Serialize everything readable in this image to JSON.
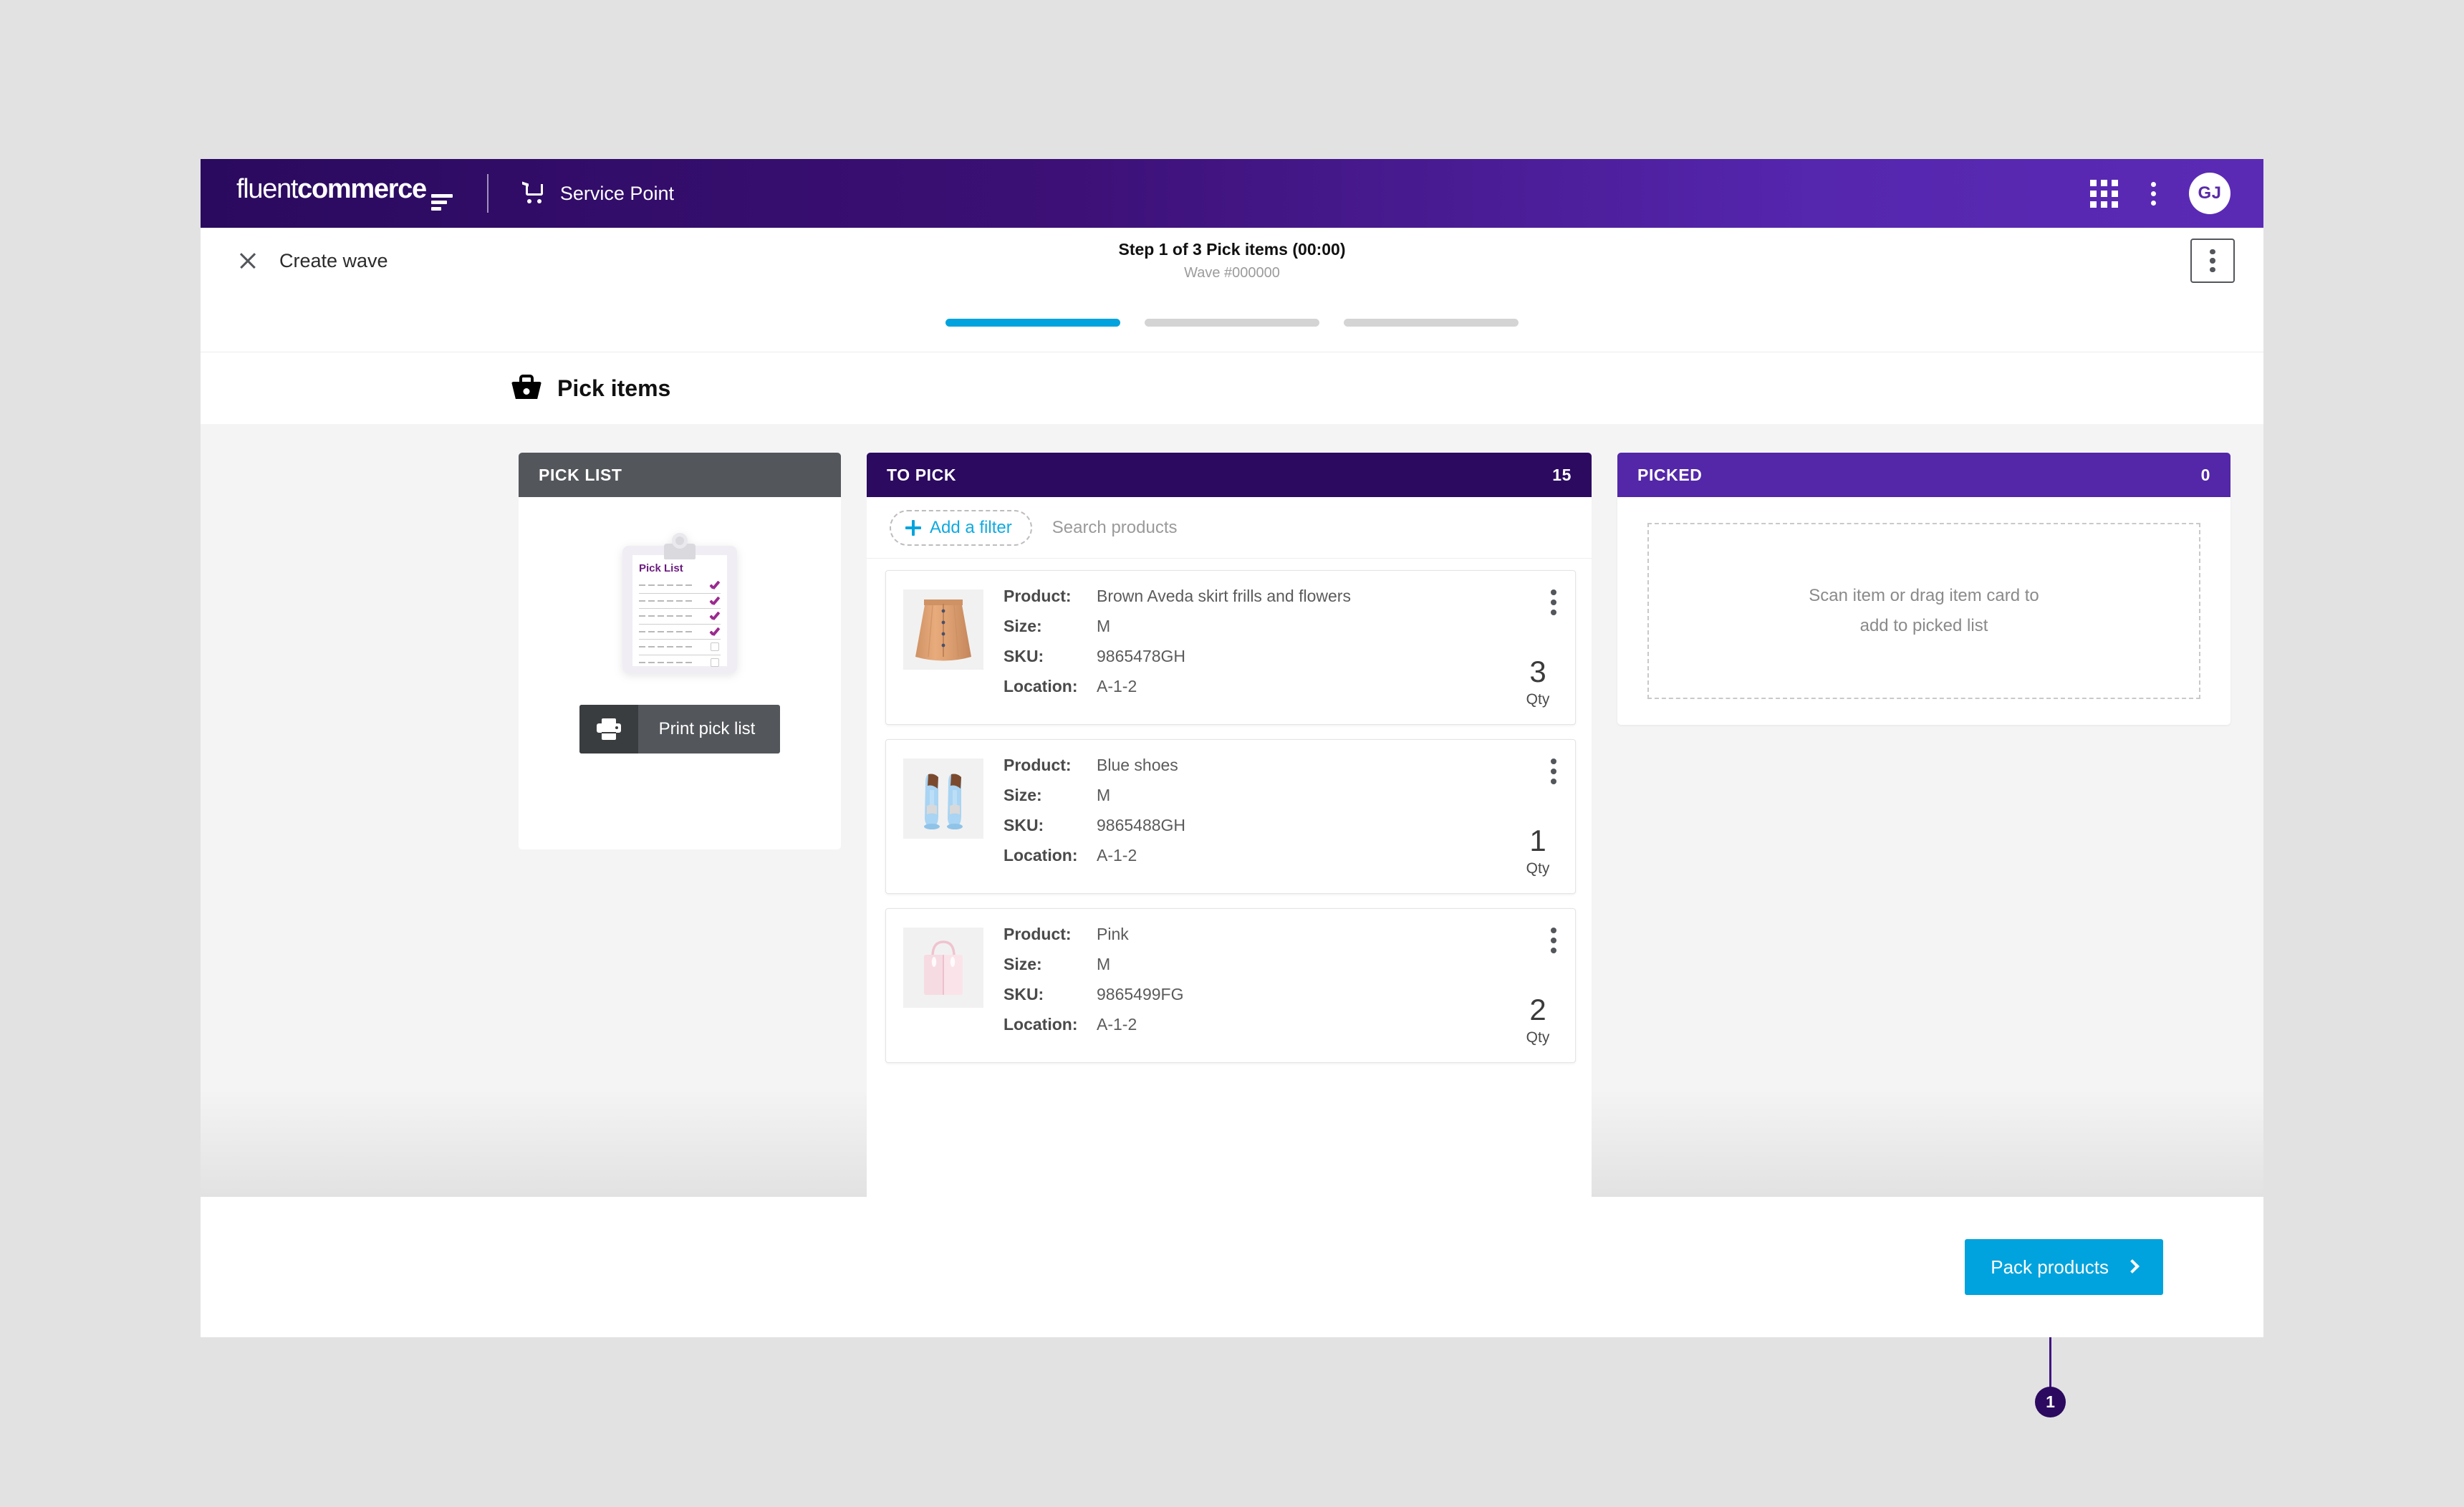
{
  "brand": {
    "logo_text_light": "fluent",
    "logo_text_bold": "commerce",
    "divider": "|",
    "app_name": "Service Point",
    "cart_icon": "shopping-cart-icon",
    "apps_icon": "apps-grid-icon",
    "kebab_icon": "more-vertical-icon",
    "avatar_initials": "GJ",
    "gradient_start": "#2a0a5e",
    "gradient_end": "#5b2ab5"
  },
  "sub_header": {
    "close_icon": "close-icon",
    "title": "Create wave",
    "step_text": "Step 1 of 3 Pick items (00:00)",
    "wave_number": "Wave #000000",
    "overflow_icon": "more-vertical-icon"
  },
  "stepper": {
    "steps": [
      {
        "state": "active"
      },
      {
        "state": "inactive"
      },
      {
        "state": "inactive"
      }
    ],
    "active_color": "#00a3dd",
    "inactive_color": "#d4d4d4"
  },
  "section": {
    "icon": "basket-icon",
    "title": "Pick items"
  },
  "pick_list_panel": {
    "header": "PICK LIST",
    "header_color": "#53565a",
    "illustration": {
      "name": "pick-list-clipboard-illustration",
      "paper_title": "Pick List",
      "checked_rows": 4,
      "unchecked_rows": 2,
      "accent_color": "#9b2a8f"
    },
    "print_button": {
      "label": "Print pick list",
      "icon": "printer-icon"
    }
  },
  "to_pick_panel": {
    "header": "TO PICK",
    "header_color": "#2b0a60",
    "count": "15",
    "add_filter_label": "Add a filter",
    "add_filter_icon": "plus-icon",
    "search_placeholder": "Search products",
    "search_value": "",
    "field_labels": {
      "product": "Product:",
      "size": "Size:",
      "sku": "SKU:",
      "location": "Location:"
    },
    "qty_label": "Qty",
    "item_kebab_icon": "more-vertical-icon",
    "items": [
      {
        "thumb": "brown-skirt-thumbnail",
        "product": "Brown Aveda skirt frills and flowers",
        "size": "M",
        "sku": "9865478GH",
        "location": "A-1-2",
        "qty": "3"
      },
      {
        "thumb": "blue-shoes-thumbnail",
        "product": "Blue shoes",
        "size": "M",
        "sku": "9865488GH",
        "location": "A-1-2",
        "qty": "1"
      },
      {
        "thumb": "pink-handbag-thumbnail",
        "product": "Pink",
        "size": "M",
        "sku": "9865499FG",
        "location": "A-1-2",
        "qty": "2"
      }
    ]
  },
  "picked_panel": {
    "header": "PICKED",
    "header_color": "#5327a8",
    "count": "0",
    "dropzone_line1": "Scan item or drag item card to",
    "dropzone_line2": "add to picked list"
  },
  "footer": {
    "pack_button_label": "Pack products",
    "pack_button_icon": "chevron-right-icon",
    "pack_button_color": "#00a3dd"
  },
  "callout": {
    "number": "1",
    "color": "#2b0a60"
  }
}
